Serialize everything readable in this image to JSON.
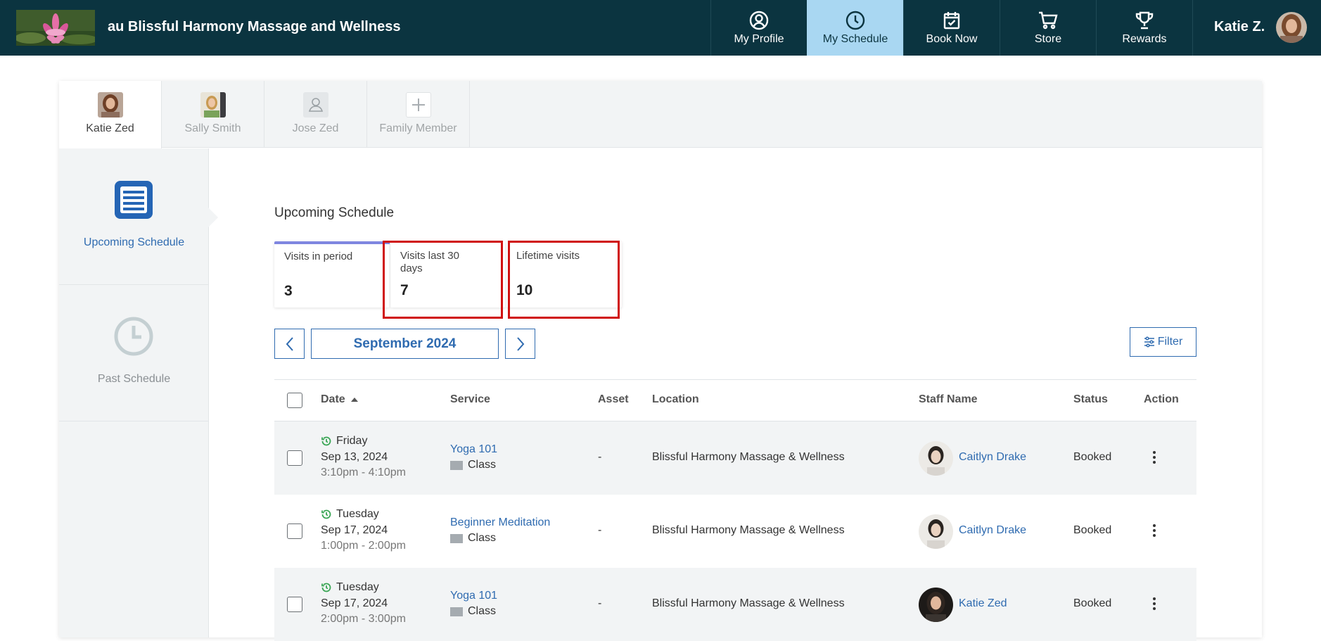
{
  "header": {
    "business_name": "au Blissful Harmony Massage and Wellness",
    "nav": [
      {
        "label": "My Profile",
        "icon": "user-circle-icon"
      },
      {
        "label": "My Schedule",
        "icon": "clock-icon",
        "active": true
      },
      {
        "label": "Book Now",
        "icon": "calendar-check-icon"
      },
      {
        "label": "Store",
        "icon": "cart-icon"
      },
      {
        "label": "Rewards",
        "icon": "trophy-icon"
      }
    ],
    "user_name": "Katie Z."
  },
  "members": [
    {
      "name": "Katie Zed",
      "active": true
    },
    {
      "name": "Sally Smith"
    },
    {
      "name": "Jose Zed"
    },
    {
      "name": "Family Member"
    }
  ],
  "sidebar": {
    "items": [
      {
        "label": "Upcoming Schedule",
        "icon": "list-icon",
        "active": true
      },
      {
        "label": "Past Schedule",
        "icon": "clock-icon"
      }
    ]
  },
  "main": {
    "title": "Upcoming Schedule",
    "stats": [
      {
        "label": "Visits in period",
        "value": "3"
      },
      {
        "label": "Visits last 30 days",
        "value": "7"
      },
      {
        "label": "Lifetime visits",
        "value": "10"
      }
    ],
    "month": "September 2024",
    "filter_label": "Filter"
  },
  "table": {
    "columns": [
      "Date",
      "Service",
      "Asset",
      "Location",
      "Staff Name",
      "Status",
      "Action"
    ],
    "sort_column": "Date",
    "rows": [
      {
        "day": "Friday",
        "date": "Sep 13, 2024",
        "time": "3:10pm - 4:10pm",
        "service": "Yoga 101",
        "type": "Class",
        "asset": "-",
        "location": "Blissful Harmony Massage & Wellness",
        "staff": "Caitlyn Drake",
        "status": "Booked"
      },
      {
        "day": "Tuesday",
        "date": "Sep 17, 2024",
        "time": "1:00pm - 2:00pm",
        "service": "Beginner Meditation",
        "type": "Class",
        "asset": "-",
        "location": "Blissful Harmony Massage & Wellness",
        "staff": "Caitlyn Drake",
        "status": "Booked"
      },
      {
        "day": "Tuesday",
        "date": "Sep 17, 2024",
        "time": "2:00pm - 3:00pm",
        "service": "Yoga 101",
        "type": "Class",
        "asset": "-",
        "location": "Blissful Harmony Massage & Wellness",
        "staff": "Katie Zed",
        "status": "Booked"
      }
    ]
  },
  "colors": {
    "topbar": "#0b3440",
    "nav_active": "#a9d7f2",
    "accent_blue": "#2f6bb0",
    "highlight_red": "#d01111",
    "status_green": "#3aa655"
  }
}
